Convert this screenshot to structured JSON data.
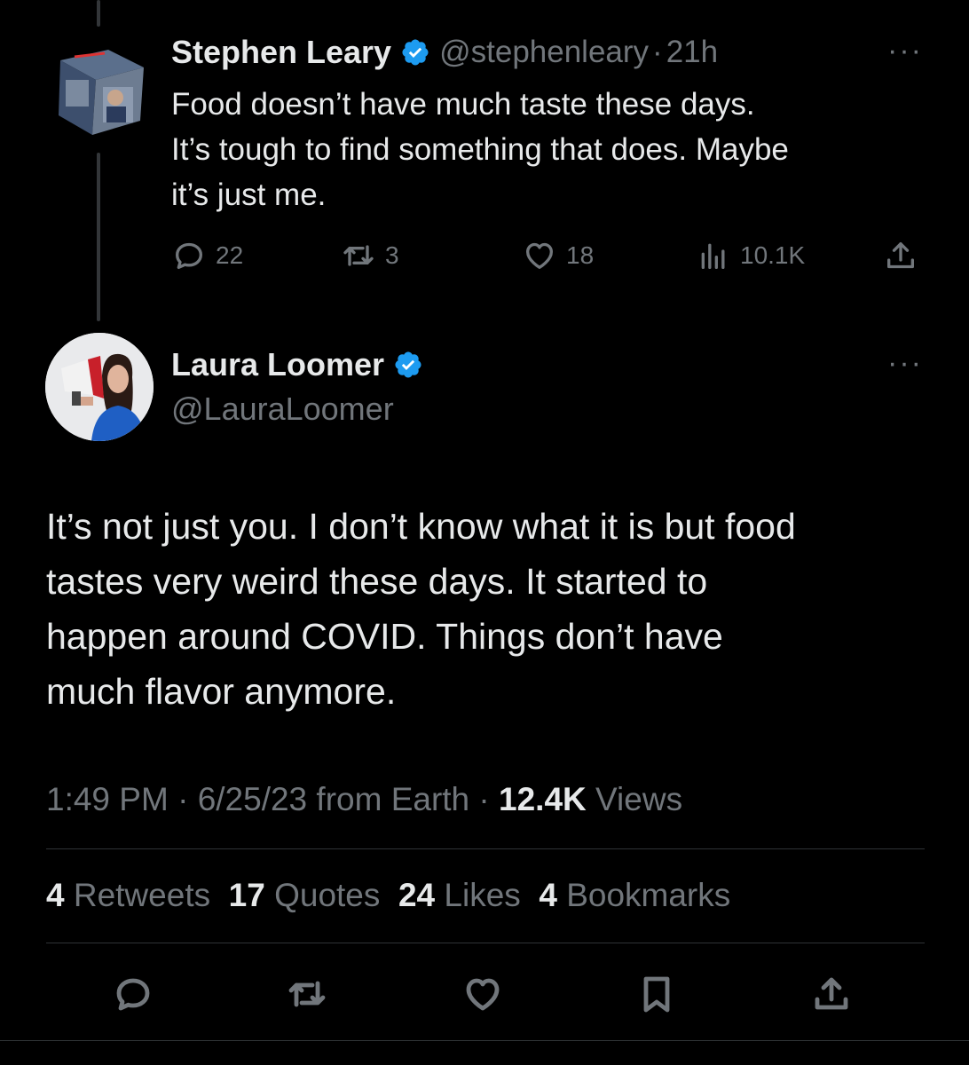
{
  "reply_to": {
    "name": "Stephen Leary",
    "handle": "@stephenleary",
    "separator": "·",
    "time": "21h",
    "lines": [
      "Food doesn’t have much taste these days.",
      "It’s tough to find something that does. Maybe",
      "it’s just me."
    ],
    "replies": "22",
    "retweets": "3",
    "likes": "18",
    "views": "10.1K",
    "more_label": "···"
  },
  "main_tweet": {
    "name": "Laura Loomer",
    "handle": "@LauraLoomer",
    "more_label": "···",
    "lines": [
      "It’s not just you. I don’t know what it is but food",
      "tastes very weird these days. It started to",
      "happen around COVID. Things don’t have",
      "much flavor anymore."
    ],
    "meta": {
      "time": "1:49 PM",
      "date": "6/25/23",
      "source": "from Earth",
      "views_count": "12.4K",
      "views_label": "Views",
      "sep": "·"
    },
    "stats": {
      "retweets_count": "4",
      "retweets_label": "Retweets",
      "quotes_count": "17",
      "quotes_label": "Quotes",
      "likes_count": "24",
      "likes_label": "Likes",
      "bookmarks_count": "4",
      "bookmarks_label": "Bookmarks"
    }
  },
  "icons": {
    "verified": "verified-badge-icon",
    "reply": "reply-icon",
    "retweet": "retweet-icon",
    "like": "heart-icon",
    "views": "bar-chart-icon",
    "share": "share-icon",
    "bookmark": "bookmark-icon"
  },
  "colors": {
    "background": "#000000",
    "text": "#e7e9ea",
    "muted": "#71767b",
    "verified": "#1d9bf0",
    "divider": "#2f3336"
  }
}
